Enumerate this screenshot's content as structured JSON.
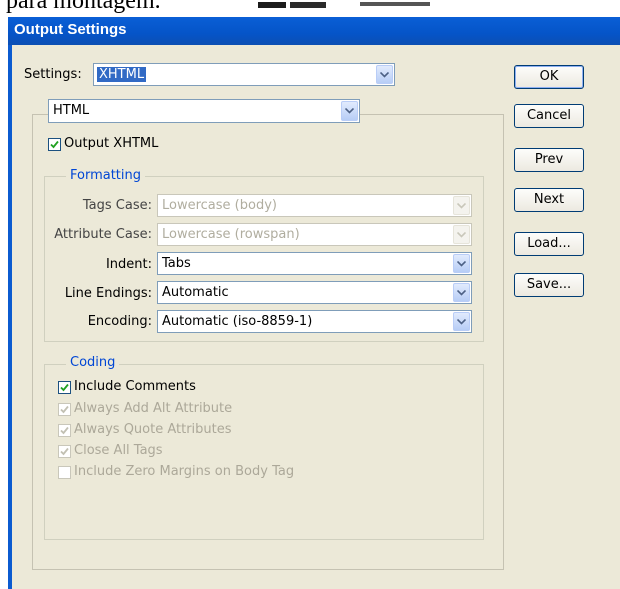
{
  "crop_text": "para montagem.",
  "window": {
    "title": "Output Settings"
  },
  "settings": {
    "label": "Settings:",
    "value": "XHTML"
  },
  "format_select": {
    "value": "HTML"
  },
  "output_xhtml": {
    "label": "Output XHTML",
    "checked": true
  },
  "formatting": {
    "legend": "Formatting",
    "tags_case": {
      "label": "Tags Case:",
      "value": "Lowercase (body)",
      "enabled": false
    },
    "attribute_case": {
      "label": "Attribute Case:",
      "value": "Lowercase (rowspan)",
      "enabled": false
    },
    "indent": {
      "label": "Indent:",
      "value": "Tabs",
      "enabled": true
    },
    "line_endings": {
      "label": "Line Endings:",
      "value": "Automatic",
      "enabled": true
    },
    "encoding": {
      "label": "Encoding:",
      "value": "Automatic (iso-8859-1)",
      "enabled": true
    }
  },
  "coding": {
    "legend": "Coding",
    "items": [
      {
        "label": "Include Comments",
        "checked": true,
        "enabled": true
      },
      {
        "label": "Always Add Alt Attribute",
        "checked": true,
        "enabled": false
      },
      {
        "label": "Always Quote Attributes",
        "checked": true,
        "enabled": false
      },
      {
        "label": "Close All Tags",
        "checked": true,
        "enabled": false
      },
      {
        "label": "Include Zero Margins on Body Tag",
        "checked": false,
        "enabled": false
      }
    ]
  },
  "buttons": {
    "ok": "OK",
    "cancel": "Cancel",
    "prev": "Prev",
    "next": "Next",
    "load": "Load...",
    "save": "Save..."
  },
  "colors": {
    "titlebar": "#0554c8",
    "dialog_bg": "#ece9d8",
    "legend_text": "#0046d5",
    "selection": "#316ac5"
  }
}
